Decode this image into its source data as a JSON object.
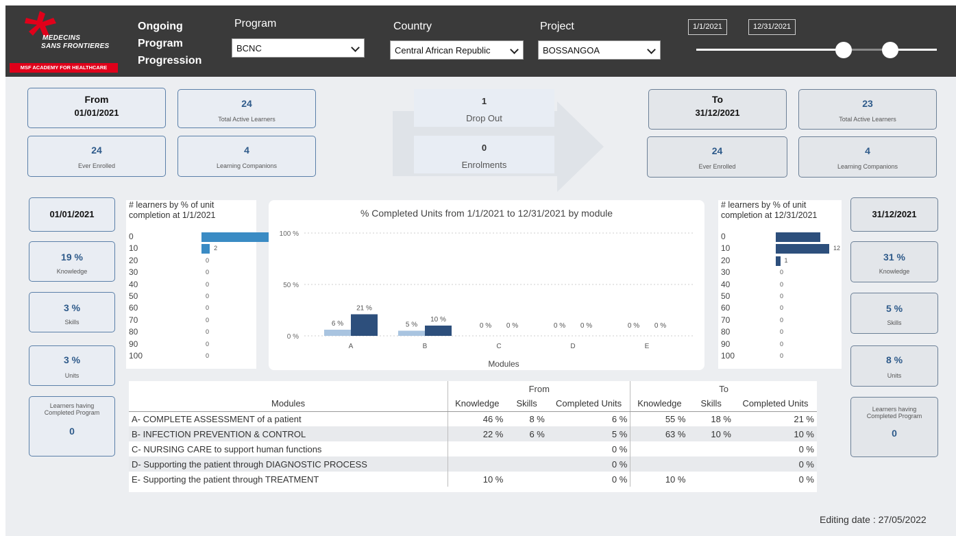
{
  "header": {
    "logo_line1": "MEDECINS",
    "logo_line2": "SANS FRONTIERES",
    "logo_banner": "MSF ACADEMY FOR HEALTHCARE",
    "title_line1": "Ongoing",
    "title_line2": "Program",
    "title_line3": "Progression",
    "program_label": "Program",
    "program_value": "BCNC",
    "country_label": "Country",
    "country_value": "Central African Republic",
    "project_label": "Project",
    "project_value": "BOSSANGOA",
    "date_start": "1/1/2021",
    "date_end": "12/31/2021"
  },
  "from": {
    "title": "From",
    "date": "01/01/2021",
    "total_active_value": "24",
    "total_active_label": "Total Active Learners",
    "ever_enrolled_value": "24",
    "ever_enrolled_label": "Ever Enrolled",
    "companions_value": "4",
    "companions_label": "Learning Companions"
  },
  "middle": {
    "dropout_value": "1",
    "dropout_label": "Drop Out",
    "enrol_value": "0",
    "enrol_label": "Enrolments"
  },
  "to": {
    "title": "To",
    "date": "31/12/2021",
    "total_active_value": "23",
    "total_active_label": "Total Active Learners",
    "ever_enrolled_value": "24",
    "ever_enrolled_label": "Ever Enrolled",
    "companions_value": "4",
    "companions_label": "Learning Companions"
  },
  "left_side": {
    "date": "01/01/2021",
    "knowledge_value": "19 %",
    "knowledge_label": "Knowledge",
    "skills_value": "3 %",
    "skills_label": "Skills",
    "units_value": "3 %",
    "units_label": "Units",
    "completed_label_1": "Learners having",
    "completed_label_2": "Completed Program",
    "completed_value": "0"
  },
  "right_side": {
    "date": "31/12/2021",
    "knowledge_value": "31 %",
    "knowledge_label": "Knowledge",
    "skills_value": "5 %",
    "skills_label": "Skills",
    "units_value": "8 %",
    "units_label": "Units",
    "completed_label_1": "Learners having",
    "completed_label_2": "Completed Program",
    "completed_value": "0"
  },
  "hist_left": {
    "title_1": "# learners by % of unit",
    "title_2": "completion at 1/1/2021",
    "rows": [
      "0",
      "10",
      "20",
      "30",
      "40",
      "50",
      "60",
      "70",
      "80",
      "90",
      "100"
    ],
    "counts": [
      22,
      2,
      0,
      0,
      0,
      0,
      0,
      0,
      0,
      0,
      0
    ],
    "labels": [
      "",
      "2",
      "0",
      "0",
      "0",
      "0",
      "0",
      "0",
      "0",
      "0",
      "0"
    ],
    "color": "#3a8bc4"
  },
  "hist_right": {
    "title_1": "# learners by % of unit",
    "title_2": "completion at 12/31/2021",
    "rows": [
      "0",
      "10",
      "20",
      "30",
      "40",
      "50",
      "60",
      "70",
      "80",
      "90",
      "100"
    ],
    "counts": [
      10,
      12,
      1,
      0,
      0,
      0,
      0,
      0,
      0,
      0,
      0
    ],
    "labels": [
      "",
      "12",
      "1",
      "0",
      "0",
      "0",
      "0",
      "0",
      "0",
      "0",
      "0"
    ],
    "color": "#2d4f7c"
  },
  "chart_data": {
    "type": "bar",
    "title": "% Completed Units from 1/1/2021 to 12/31/2021 by module",
    "xlabel": "Modules",
    "ylabel": "",
    "categories": [
      "A",
      "B",
      "C",
      "D",
      "E"
    ],
    "series": [
      {
        "values": [
          6,
          5,
          0,
          0,
          0
        ],
        "labels": [
          "6 %",
          "5 %",
          "0 %",
          "0 %",
          "0 %"
        ],
        "color": "#a9c4e0"
      },
      {
        "values": [
          21,
          10,
          0,
          0,
          0
        ],
        "labels": [
          "21 %",
          "10 %",
          "0 %",
          "0 %",
          "0 %"
        ],
        "color": "#2d4f7c"
      }
    ],
    "ylim": [
      0,
      100
    ],
    "yticks": [
      "0 %",
      "50 %",
      "100 %"
    ],
    "grid": true
  },
  "table": {
    "group_from": "From",
    "group_to": "To",
    "columns": [
      "Modules",
      "Knowledge",
      "Skills",
      "Completed Units",
      "Knowledge",
      "Skills",
      "Completed Units"
    ],
    "rows": [
      [
        "A- COMPLETE ASSESSMENT of a patient",
        "46 %",
        "8 %",
        "6 %",
        "55 %",
        "18 %",
        "21 %"
      ],
      [
        "B- INFECTION PREVENTION & CONTROL",
        "22 %",
        "6 %",
        "5 %",
        "63 %",
        "10 %",
        "10 %"
      ],
      [
        "C- NURSING CARE to support human functions",
        "",
        "",
        "0 %",
        "",
        "",
        "0 %"
      ],
      [
        "D- Supporting the patient through DIAGNOSTIC PROCESS",
        "",
        "",
        "0 %",
        "",
        "",
        "0 %"
      ],
      [
        "E- Supporting the patient through TREATMENT",
        "10 %",
        "",
        "0 %",
        "10 %",
        "",
        "0 %"
      ]
    ]
  },
  "footer": {
    "editing_date": "Editing date : 27/05/2022"
  }
}
